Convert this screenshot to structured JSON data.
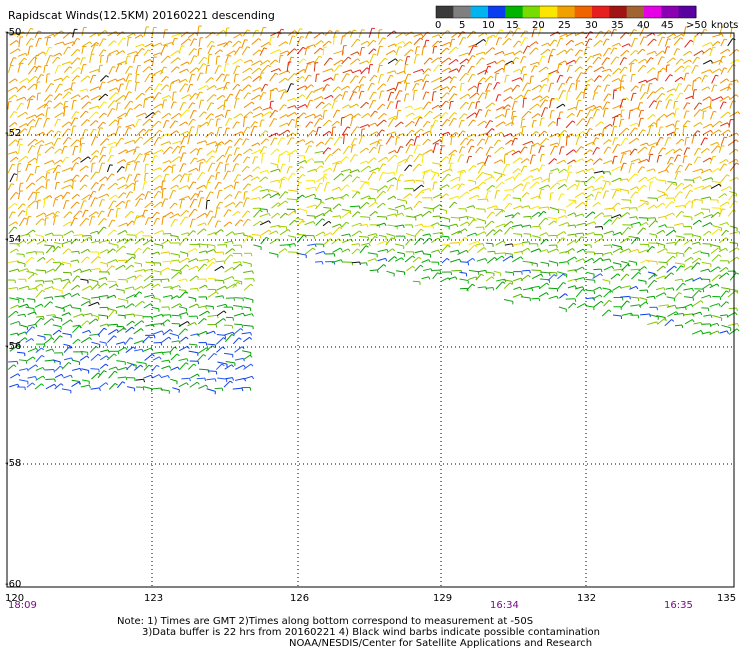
{
  "header": {
    "title": "Rapidscat Winds(12.5KM) 20160221 descending"
  },
  "legend": {
    "colors": [
      "#3a3a3a",
      "#7f7f7f",
      "#00b4f0",
      "#0a3cf0",
      "#00b400",
      "#78dc00",
      "#fae600",
      "#f0a000",
      "#f06400",
      "#e61e1e",
      "#a01414",
      "#a06432",
      "#e600e6",
      "#8c00b4",
      "#5a00a0"
    ],
    "ticks": [
      "0",
      "5",
      "10",
      "15",
      "20",
      "25",
      "30",
      "35",
      "40",
      "45",
      ">50"
    ],
    "unit": "knots"
  },
  "axes": {
    "lat_labels": [
      "-50",
      "-52",
      "-54",
      "-56",
      "-58",
      "-60"
    ],
    "lon_labels": [
      "120",
      "123",
      "126",
      "129",
      "132",
      "135"
    ],
    "time_labels": [
      "18:09",
      "16:34",
      "16:35"
    ]
  },
  "notes": {
    "line1": "Note: 1) Times are GMT 2)Times along bottom correspond to measurement at -50S",
    "line2": "3)Data buffer is 22 hrs from 20160221 4) Black wind barbs indicate possible contamination",
    "line3": "NOAA/NESDIS/Center for Satellite Applications and Research"
  },
  "map_data": {
    "lat_range": [
      -60,
      -50
    ],
    "lon_range": [
      120,
      135
    ],
    "grid": true
  }
}
